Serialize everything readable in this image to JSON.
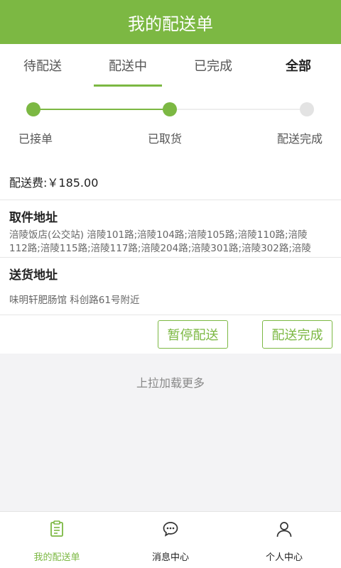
{
  "header": {
    "title": "我的配送单"
  },
  "tabs": [
    {
      "label": "待配送"
    },
    {
      "label": "配送中"
    },
    {
      "label": "已完成"
    },
    {
      "label": "全部"
    }
  ],
  "progress": {
    "steps": [
      {
        "label": "已接单"
      },
      {
        "label": "已取货"
      },
      {
        "label": "配送完成"
      }
    ]
  },
  "order": {
    "fee": "配送费:￥185.00",
    "pickup_title": "取件地址",
    "pickup_address": "涪陵饭店(公交站) 涪陵101路;涪陵104路;涪陵105路;涪陵110路;涪陵112路;涪陵115路;涪陵117路;涪陵204路;涪陵301路;涪陵302路;涪陵",
    "delivery_title": "送货地址",
    "delivery_address": "味明轩肥肠馆 科创路61号附近",
    "pause_button": "暂停配送",
    "complete_button": "配送完成"
  },
  "load_more": "上拉加载更多",
  "bottom_nav": [
    {
      "label": "我的配送单",
      "icon": "clipboard-icon"
    },
    {
      "label": "消息中心",
      "icon": "chat-icon"
    },
    {
      "label": "个人中心",
      "icon": "person-icon"
    }
  ],
  "colors": {
    "accent": "#7cb843",
    "inactive_dot": "#e3e3e3"
  }
}
